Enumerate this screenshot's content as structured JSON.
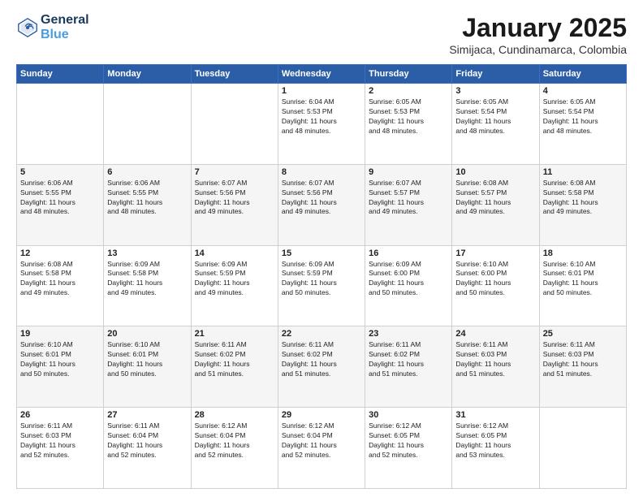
{
  "header": {
    "logo_line1": "General",
    "logo_line2": "Blue",
    "month": "January 2025",
    "location": "Simijaca, Cundinamarca, Colombia"
  },
  "weekdays": [
    "Sunday",
    "Monday",
    "Tuesday",
    "Wednesday",
    "Thursday",
    "Friday",
    "Saturday"
  ],
  "weeks": [
    {
      "shaded": false,
      "days": [
        {
          "num": "",
          "info": ""
        },
        {
          "num": "",
          "info": ""
        },
        {
          "num": "",
          "info": ""
        },
        {
          "num": "1",
          "info": "Sunrise: 6:04 AM\nSunset: 5:53 PM\nDaylight: 11 hours\nand 48 minutes."
        },
        {
          "num": "2",
          "info": "Sunrise: 6:05 AM\nSunset: 5:53 PM\nDaylight: 11 hours\nand 48 minutes."
        },
        {
          "num": "3",
          "info": "Sunrise: 6:05 AM\nSunset: 5:54 PM\nDaylight: 11 hours\nand 48 minutes."
        },
        {
          "num": "4",
          "info": "Sunrise: 6:05 AM\nSunset: 5:54 PM\nDaylight: 11 hours\nand 48 minutes."
        }
      ]
    },
    {
      "shaded": true,
      "days": [
        {
          "num": "5",
          "info": "Sunrise: 6:06 AM\nSunset: 5:55 PM\nDaylight: 11 hours\nand 48 minutes."
        },
        {
          "num": "6",
          "info": "Sunrise: 6:06 AM\nSunset: 5:55 PM\nDaylight: 11 hours\nand 48 minutes."
        },
        {
          "num": "7",
          "info": "Sunrise: 6:07 AM\nSunset: 5:56 PM\nDaylight: 11 hours\nand 49 minutes."
        },
        {
          "num": "8",
          "info": "Sunrise: 6:07 AM\nSunset: 5:56 PM\nDaylight: 11 hours\nand 49 minutes."
        },
        {
          "num": "9",
          "info": "Sunrise: 6:07 AM\nSunset: 5:57 PM\nDaylight: 11 hours\nand 49 minutes."
        },
        {
          "num": "10",
          "info": "Sunrise: 6:08 AM\nSunset: 5:57 PM\nDaylight: 11 hours\nand 49 minutes."
        },
        {
          "num": "11",
          "info": "Sunrise: 6:08 AM\nSunset: 5:58 PM\nDaylight: 11 hours\nand 49 minutes."
        }
      ]
    },
    {
      "shaded": false,
      "days": [
        {
          "num": "12",
          "info": "Sunrise: 6:08 AM\nSunset: 5:58 PM\nDaylight: 11 hours\nand 49 minutes."
        },
        {
          "num": "13",
          "info": "Sunrise: 6:09 AM\nSunset: 5:58 PM\nDaylight: 11 hours\nand 49 minutes."
        },
        {
          "num": "14",
          "info": "Sunrise: 6:09 AM\nSunset: 5:59 PM\nDaylight: 11 hours\nand 49 minutes."
        },
        {
          "num": "15",
          "info": "Sunrise: 6:09 AM\nSunset: 5:59 PM\nDaylight: 11 hours\nand 50 minutes."
        },
        {
          "num": "16",
          "info": "Sunrise: 6:09 AM\nSunset: 6:00 PM\nDaylight: 11 hours\nand 50 minutes."
        },
        {
          "num": "17",
          "info": "Sunrise: 6:10 AM\nSunset: 6:00 PM\nDaylight: 11 hours\nand 50 minutes."
        },
        {
          "num": "18",
          "info": "Sunrise: 6:10 AM\nSunset: 6:01 PM\nDaylight: 11 hours\nand 50 minutes."
        }
      ]
    },
    {
      "shaded": true,
      "days": [
        {
          "num": "19",
          "info": "Sunrise: 6:10 AM\nSunset: 6:01 PM\nDaylight: 11 hours\nand 50 minutes."
        },
        {
          "num": "20",
          "info": "Sunrise: 6:10 AM\nSunset: 6:01 PM\nDaylight: 11 hours\nand 50 minutes."
        },
        {
          "num": "21",
          "info": "Sunrise: 6:11 AM\nSunset: 6:02 PM\nDaylight: 11 hours\nand 51 minutes."
        },
        {
          "num": "22",
          "info": "Sunrise: 6:11 AM\nSunset: 6:02 PM\nDaylight: 11 hours\nand 51 minutes."
        },
        {
          "num": "23",
          "info": "Sunrise: 6:11 AM\nSunset: 6:02 PM\nDaylight: 11 hours\nand 51 minutes."
        },
        {
          "num": "24",
          "info": "Sunrise: 6:11 AM\nSunset: 6:03 PM\nDaylight: 11 hours\nand 51 minutes."
        },
        {
          "num": "25",
          "info": "Sunrise: 6:11 AM\nSunset: 6:03 PM\nDaylight: 11 hours\nand 51 minutes."
        }
      ]
    },
    {
      "shaded": false,
      "days": [
        {
          "num": "26",
          "info": "Sunrise: 6:11 AM\nSunset: 6:03 PM\nDaylight: 11 hours\nand 52 minutes."
        },
        {
          "num": "27",
          "info": "Sunrise: 6:11 AM\nSunset: 6:04 PM\nDaylight: 11 hours\nand 52 minutes."
        },
        {
          "num": "28",
          "info": "Sunrise: 6:12 AM\nSunset: 6:04 PM\nDaylight: 11 hours\nand 52 minutes."
        },
        {
          "num": "29",
          "info": "Sunrise: 6:12 AM\nSunset: 6:04 PM\nDaylight: 11 hours\nand 52 minutes."
        },
        {
          "num": "30",
          "info": "Sunrise: 6:12 AM\nSunset: 6:05 PM\nDaylight: 11 hours\nand 52 minutes."
        },
        {
          "num": "31",
          "info": "Sunrise: 6:12 AM\nSunset: 6:05 PM\nDaylight: 11 hours\nand 53 minutes."
        },
        {
          "num": "",
          "info": ""
        }
      ]
    }
  ]
}
